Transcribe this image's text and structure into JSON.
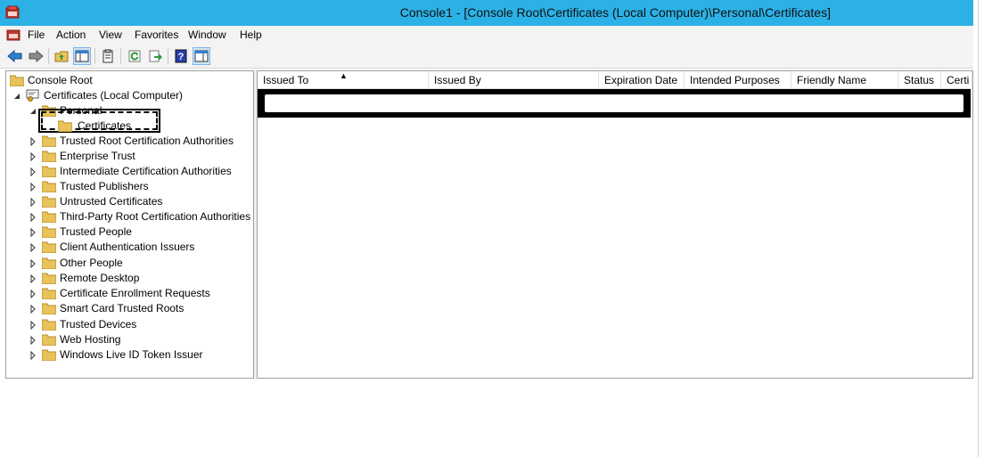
{
  "window": {
    "title": "Console1 - [Console Root\\Certificates (Local Computer)\\Personal\\Certificates]"
  },
  "menu": {
    "items": [
      "File",
      "Action",
      "View",
      "Favorites",
      "Window",
      "Help"
    ]
  },
  "toolbar": {
    "buttons": [
      "back-icon",
      "forward-icon",
      "up-folder-icon",
      "show-hide-tree-icon",
      "properties-icon",
      "refresh-icon",
      "export-list-icon",
      "help-icon",
      "show-action-pane-icon"
    ]
  },
  "tree": {
    "root": "Console Root",
    "computer": "Certificates (Local Computer)",
    "personal": "Personal",
    "selected": "Certificates",
    "stores": [
      "Trusted Root Certification Authorities",
      "Enterprise Trust",
      "Intermediate Certification Authorities",
      "Trusted Publishers",
      "Untrusted Certificates",
      "Third-Party Root Certification Authorities",
      "Trusted People",
      "Client Authentication Issuers",
      "Other People",
      "Remote Desktop",
      "Certificate Enrollment Requests",
      "Smart Card Trusted Roots",
      "Trusted Devices",
      "Web Hosting",
      "Windows Live ID Token Issuer"
    ]
  },
  "list": {
    "columns": [
      "Issued To",
      "Issued By",
      "Expiration Date",
      "Intended Purposes",
      "Friendly Name",
      "Status",
      "Certi"
    ],
    "sort_column": "Issued To",
    "sort_direction": "ascending"
  },
  "colors": {
    "titlebar": "#2bb1e6",
    "folder": "#e8c25a"
  }
}
